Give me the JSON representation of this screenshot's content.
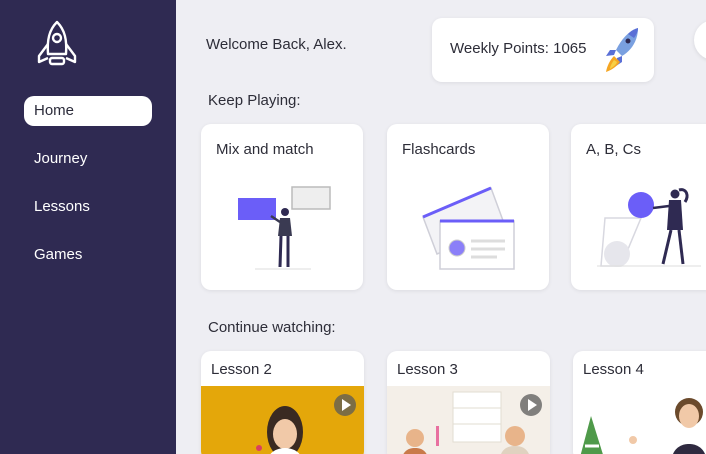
{
  "sidebar": {
    "logo_icon": "rocket-icon",
    "items": [
      {
        "label": "Home",
        "active": true
      },
      {
        "label": "Journey",
        "active": false
      },
      {
        "label": "Lessons",
        "active": false
      },
      {
        "label": "Games",
        "active": false
      }
    ]
  },
  "header": {
    "welcome": "Welcome Back, Alex.",
    "points_label": "Weekly Points: 1065"
  },
  "games": {
    "section_title": "Keep Playing:",
    "items": [
      {
        "title": "Mix and match"
      },
      {
        "title": "Flashcards"
      },
      {
        "title": "A, B, Cs"
      }
    ]
  },
  "lessons": {
    "section_title": "Continue watching:",
    "items": [
      {
        "title": "Lesson 2"
      },
      {
        "title": "Lesson 3"
      },
      {
        "title": "Lesson 4"
      }
    ]
  },
  "colors": {
    "sidebar_bg": "#2f2a52",
    "accent": "#6b5ef8",
    "page_bg": "#eeeef3"
  }
}
